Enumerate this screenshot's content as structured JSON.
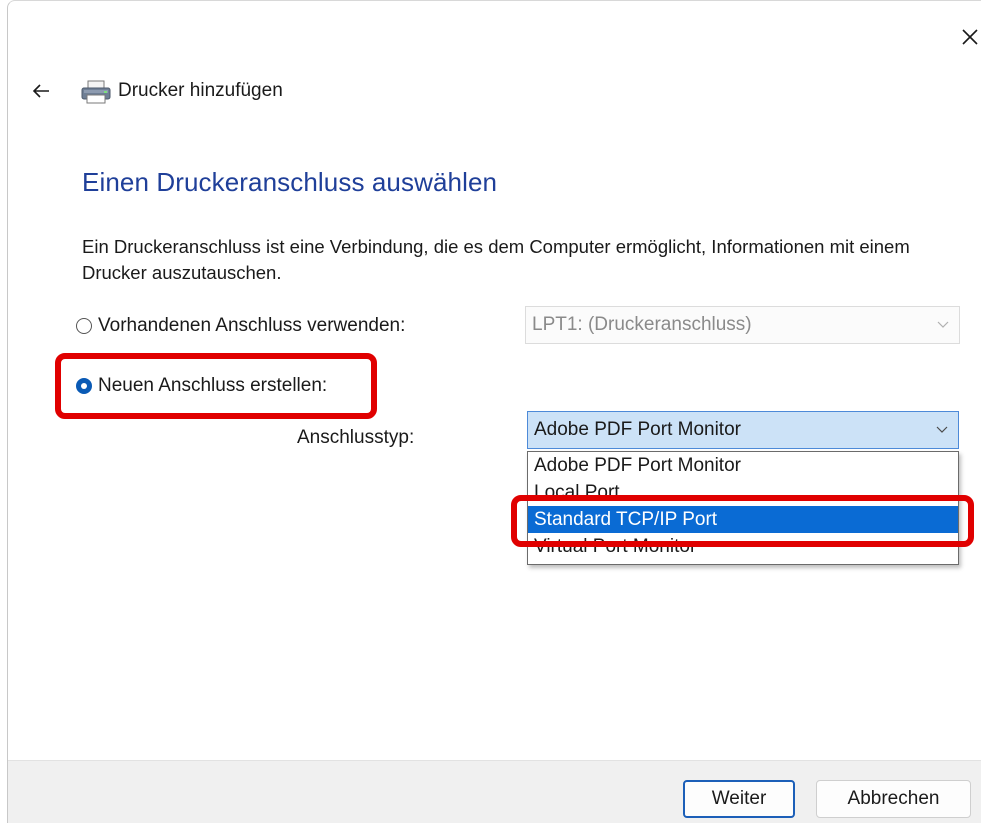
{
  "window": {
    "title": "Drucker hinzufügen",
    "close_icon": "close-icon",
    "back_icon": "arrow-left-icon",
    "app_icon": "printer-icon"
  },
  "page": {
    "heading": "Einen Druckeranschluss auswählen",
    "description": "Ein Druckeranschluss ist eine Verbindung, die es dem Computer ermöglicht, Informationen mit einem Drucker auszutauschen."
  },
  "options": {
    "existing_port": {
      "label": "Vorhandenen Anschluss verwenden:",
      "checked": false,
      "select_value": "LPT1: (Druckeranschluss)",
      "disabled": true
    },
    "new_port": {
      "label": "Neuen Anschluss erstellen:",
      "checked": true
    }
  },
  "port_type": {
    "label": "Anschlusstyp:",
    "selected_value": "Adobe PDF Port Monitor",
    "dropdown_items": [
      "Adobe PDF Port Monitor",
      "Local Port",
      "Standard TCP/IP Port",
      "Virtual Port Monitor"
    ],
    "highlighted_item": "Standard TCP/IP Port"
  },
  "footer": {
    "next_label": "Weiter",
    "cancel_label": "Abbrechen"
  },
  "colors": {
    "heading": "#1f3f99",
    "accent": "#0a5ab5",
    "selection": "#0a6bd4",
    "annotation_red": "#e00000",
    "footer_bg": "#f0f0f0"
  }
}
